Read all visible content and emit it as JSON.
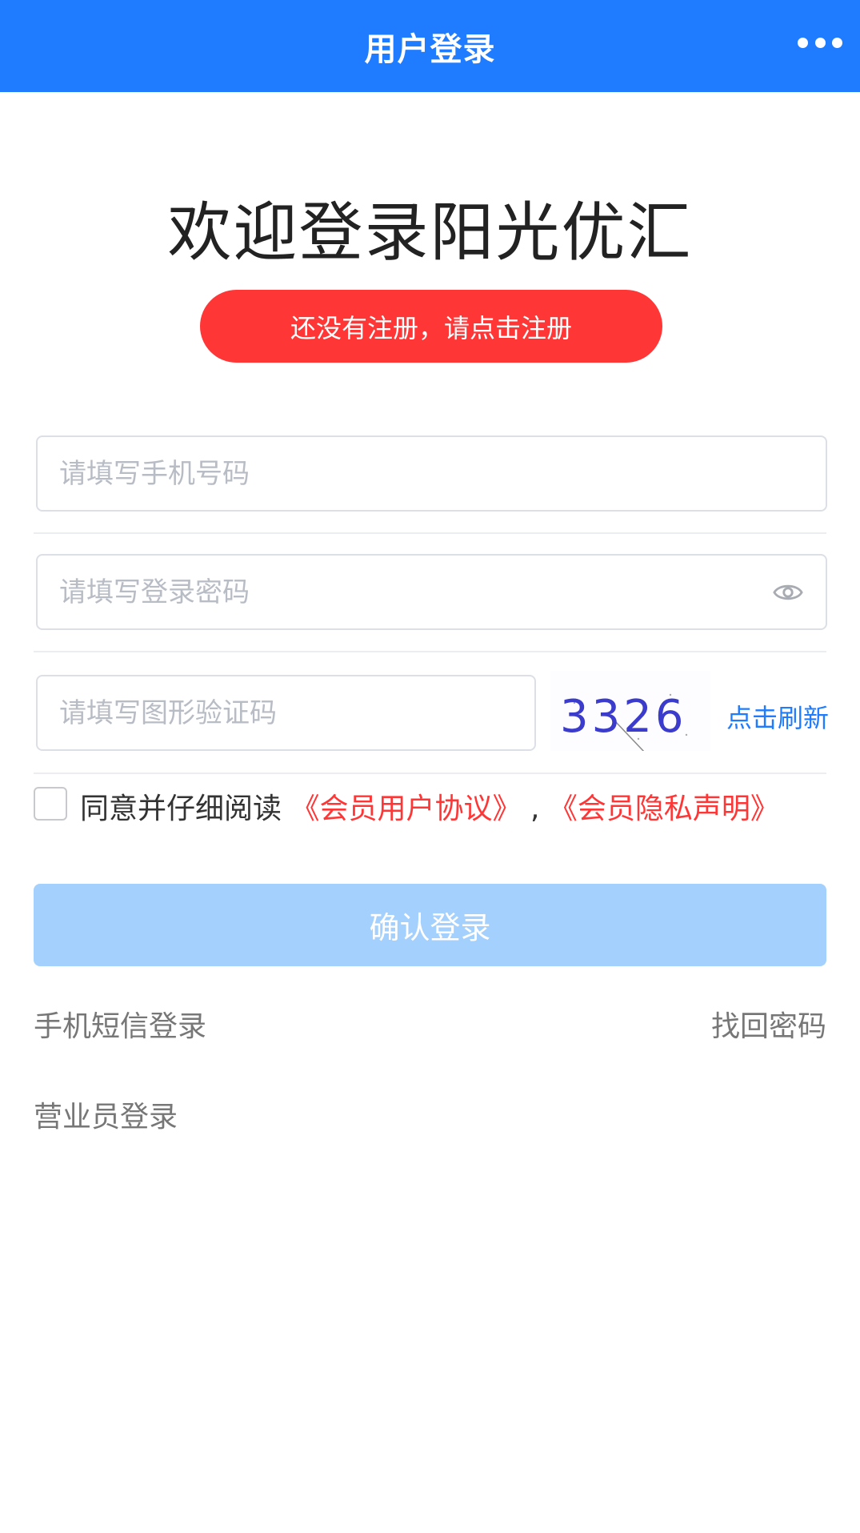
{
  "navbar": {
    "title": "用户登录",
    "background": "#1f7cff"
  },
  "welcome": {
    "title": "欢迎登录阳光优汇"
  },
  "register": {
    "label": "还没有注册，请点击注册",
    "color": "#ff3636"
  },
  "form": {
    "phone": {
      "placeholder": "请填写手机号码",
      "value": ""
    },
    "password": {
      "placeholder": "请填写登录密码",
      "value": ""
    },
    "captcha": {
      "placeholder": "请填写图形验证码",
      "value": ""
    },
    "captcha_image": {
      "code": "3326"
    },
    "refresh_label": "点击刷新"
  },
  "agreement": {
    "prefix": "同意并仔细阅读",
    "user_agreement": "《会员用户协议》",
    "separator": ",",
    "privacy_statement": "《会员隐私声明》",
    "checked": false
  },
  "login_button": {
    "label": "确认登录",
    "color": "#a3d0fd"
  },
  "links": {
    "sms_login": "手机短信登录",
    "find_password": "找回密码",
    "staff_login": "营业员登录"
  }
}
